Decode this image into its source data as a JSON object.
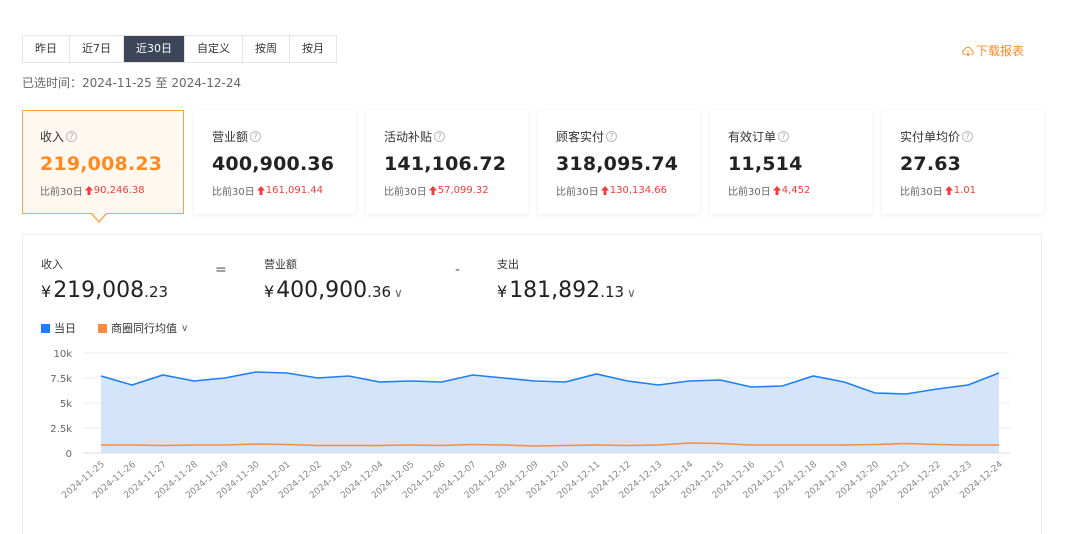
{
  "tabs": [
    {
      "label": "昨日",
      "active": false
    },
    {
      "label": "近7日",
      "active": false
    },
    {
      "label": "近30日",
      "active": true
    },
    {
      "label": "自定义",
      "active": false
    },
    {
      "label": "按周",
      "active": false
    },
    {
      "label": "按月",
      "active": false
    }
  ],
  "download": {
    "label": "下载报表",
    "icon": "cloud-download-icon",
    "color": "#ff8a1f"
  },
  "selected_time": "已选时间：2024-11-25 至 2024-12-24",
  "cards": [
    {
      "label": "收入",
      "value": "219,008.23",
      "compare_label": "比前30日",
      "delta": "90,246.38",
      "active": true
    },
    {
      "label": "营业额",
      "value": "400,900.36",
      "compare_label": "比前30日",
      "delta": "161,091.44",
      "active": false
    },
    {
      "label": "活动补贴",
      "value": "141,106.72",
      "compare_label": "比前30日",
      "delta": "57,099.32",
      "active": false
    },
    {
      "label": "顾客实付",
      "value": "318,095.74",
      "compare_label": "比前30日",
      "delta": "130,134.66",
      "active": false
    },
    {
      "label": "有效订单",
      "value": "11,514",
      "compare_label": "比前30日",
      "delta": "4,452",
      "active": false
    },
    {
      "label": "实付单均价",
      "value": "27.63",
      "compare_label": "比前30日",
      "delta": "1.01",
      "active": false
    }
  ],
  "formula": {
    "income": {
      "label": "收入",
      "currency": "¥",
      "int": "219,008",
      "dec": ".23"
    },
    "eq": "=",
    "revenue": {
      "label": "营业额",
      "currency": "¥",
      "int": "400,900",
      "dec": ".36",
      "chevron": "∨"
    },
    "minus": "-",
    "expense": {
      "label": "支出",
      "currency": "¥",
      "int": "181,892",
      "dec": ".13",
      "chevron": "∨"
    }
  },
  "legend": [
    {
      "label": "当日",
      "color": "#1e7ff0"
    },
    {
      "label": "商圈同行均值",
      "color": "#ff8a3d",
      "chevron": "∨"
    }
  ],
  "colors": {
    "accent": "#ff8a1f",
    "up": "#f23c3c",
    "tab_active_bg": "#3d4658",
    "series_daily": "#1e7ff0",
    "series_daily_fill": "#cfe2fb",
    "series_avg": "#ff8a3d"
  },
  "chart_data": {
    "type": "area",
    "x": [
      "2024-11-25",
      "2024-11-26",
      "2024-11-27",
      "2024-11-28",
      "2024-11-29",
      "2024-11-30",
      "2024-12-01",
      "2024-12-02",
      "2024-12-03",
      "2024-12-04",
      "2024-12-05",
      "2024-12-06",
      "2024-12-07",
      "2024-12-08",
      "2024-12-09",
      "2024-12-10",
      "2024-12-11",
      "2024-12-12",
      "2024-12-13",
      "2024-12-14",
      "2024-12-15",
      "2024-12-16",
      "2024-12-17",
      "2024-12-18",
      "2024-12-19",
      "2024-12-20",
      "2024-12-21",
      "2024-12-22",
      "2024-12-23",
      "2024-12-24"
    ],
    "series": [
      {
        "name": "当日",
        "values": [
          7700,
          6800,
          7800,
          7200,
          7500,
          8100,
          8000,
          7500,
          7700,
          7100,
          7200,
          7100,
          7800,
          7500,
          7200,
          7100,
          7900,
          7200,
          6800,
          7200,
          7300,
          6600,
          6700,
          7700,
          7100,
          6000,
          5900,
          6400,
          6800,
          8000
        ]
      },
      {
        "name": "商圈同行均值",
        "values": [
          800,
          800,
          750,
          800,
          800,
          900,
          850,
          750,
          750,
          750,
          800,
          750,
          850,
          800,
          700,
          750,
          800,
          750,
          800,
          1000,
          950,
          800,
          800,
          800,
          800,
          850,
          950,
          850,
          800,
          800
        ]
      }
    ],
    "yticks": [
      "0",
      "2.5k",
      "5k",
      "7.5k",
      "10k"
    ],
    "ylim": [
      0,
      10000
    ],
    "grid": true
  }
}
